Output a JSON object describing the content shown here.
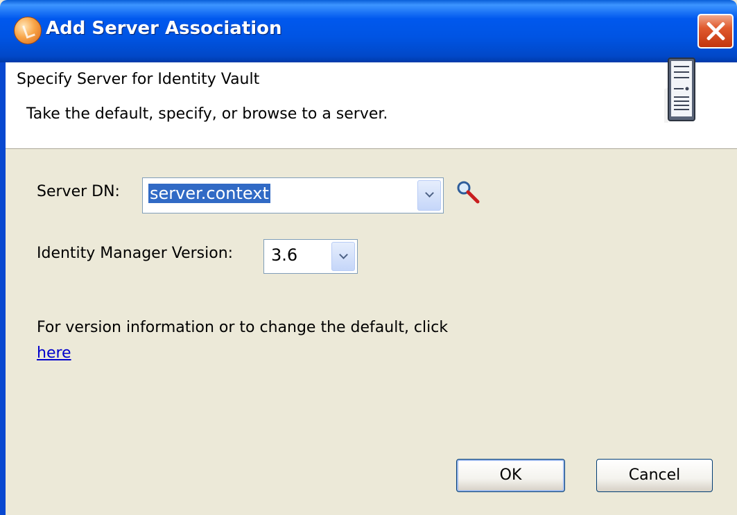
{
  "window": {
    "title": "Add Server Association"
  },
  "banner": {
    "title": "Specify Server for Identity Vault",
    "description": "Take the default, specify, or browse to a server."
  },
  "form": {
    "server_dn_label": "Server DN:",
    "server_dn_value": "server.context",
    "idm_version_label": "Identity Manager Version:",
    "idm_version_value": "3.6"
  },
  "info": {
    "text": "For version information or to change the default, click",
    "link_text": "here"
  },
  "buttons": {
    "ok_label": "OK",
    "cancel_label": "Cancel"
  },
  "icons": {
    "title": "app-icon",
    "close": "close-icon",
    "banner": "server-icon",
    "browse": "search-icon"
  },
  "colors": {
    "titlebar": "#0054E3",
    "close": "#E05A2E",
    "dialog_bg": "#ECE9D8",
    "selection": "#316AC5",
    "link": "#0000CC"
  }
}
